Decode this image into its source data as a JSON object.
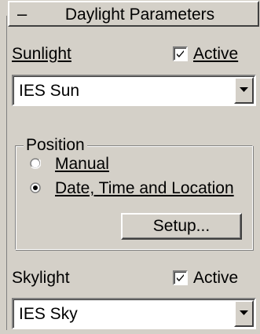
{
  "rollout": {
    "collapse_symbol": "–",
    "title": "Daylight Parameters"
  },
  "sunlight": {
    "label": "Sunlight",
    "active_label": "Active",
    "active_checked": true,
    "dropdown_value": "IES Sun"
  },
  "position": {
    "legend": "Position",
    "options": [
      {
        "label": "Manual",
        "selected": false
      },
      {
        "label": "Date, Time and Location",
        "selected": true
      }
    ],
    "setup_label": "Setup..."
  },
  "skylight": {
    "label": "Skylight",
    "active_label": "Active",
    "active_checked": true,
    "dropdown_value": "IES Sky"
  },
  "icons": {
    "checkmark": "checkmark-icon",
    "dropdown_arrow": "dropdown-arrow-icon",
    "radio": "radio-button-icon"
  }
}
